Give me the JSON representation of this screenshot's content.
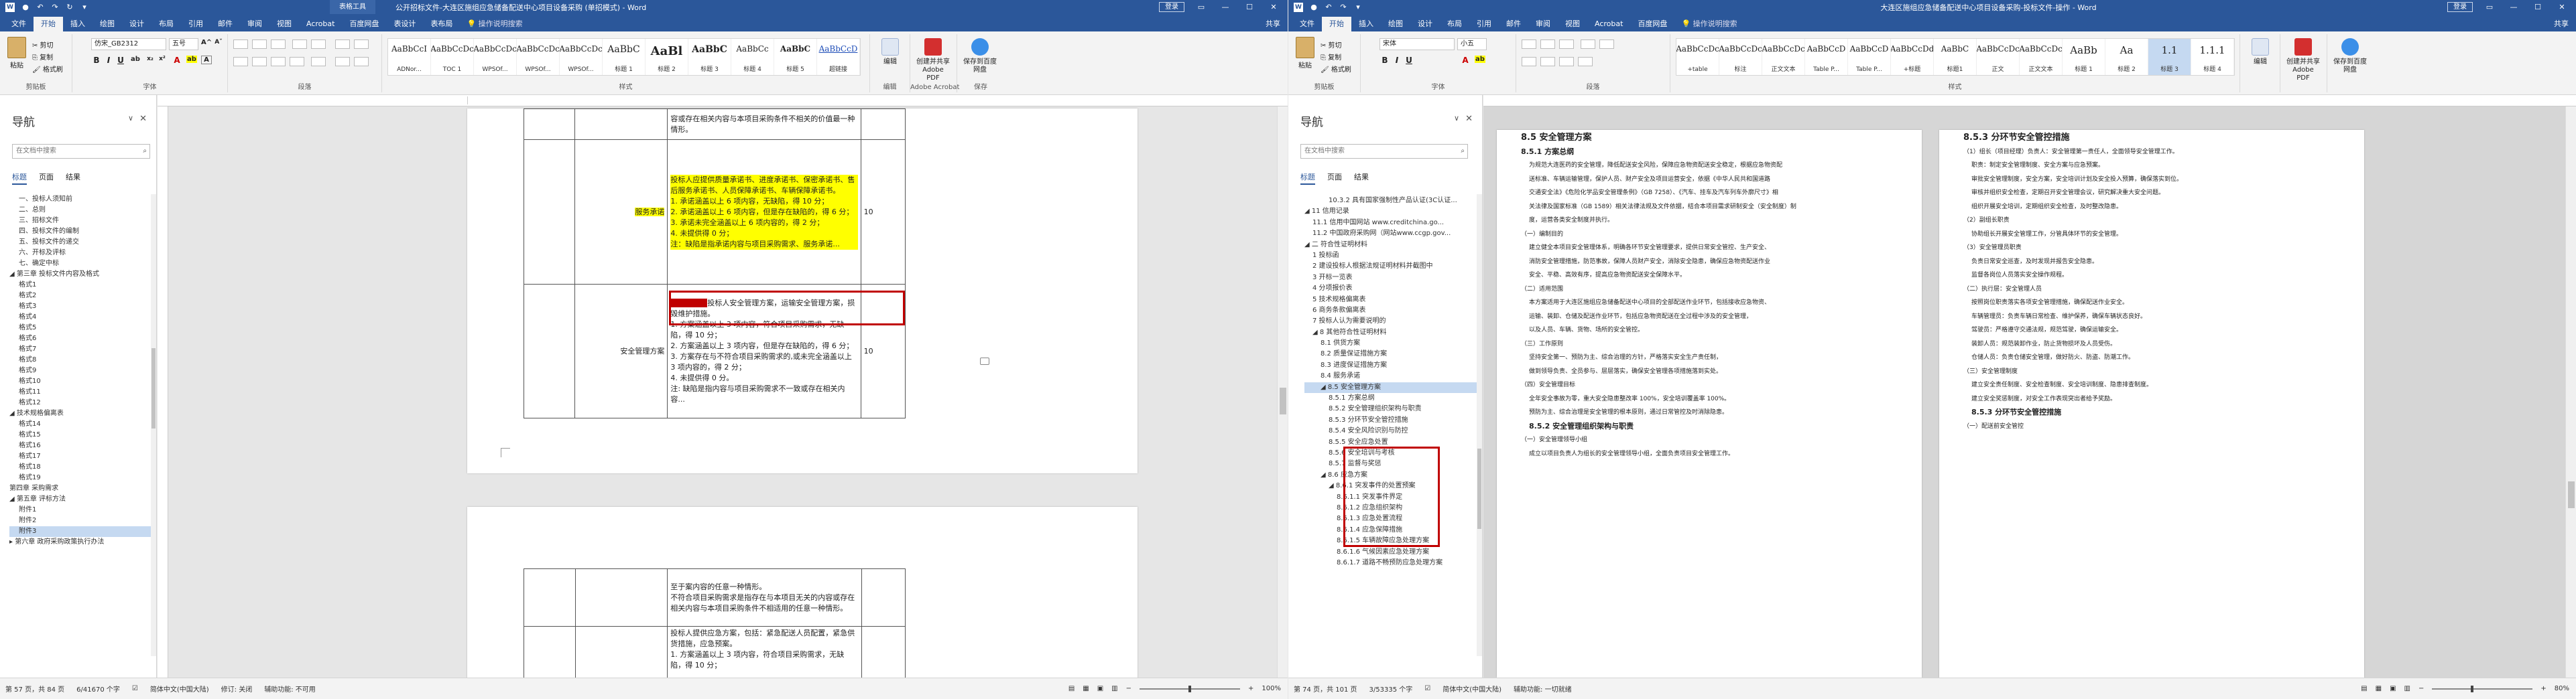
{
  "left_window": {
    "quick_access": [
      "↶",
      "↷",
      "↻",
      "▾"
    ],
    "context_tab": "表格工具",
    "title": "公开招标文件-大连区施组应急储备配送中心项目设备采购 (单招模式) - Word",
    "signin": "登录",
    "tabs": [
      "文件",
      "开始",
      "插入",
      "绘图",
      "设计",
      "布局",
      "引用",
      "邮件",
      "审阅",
      "视图",
      "Acrobat",
      "百度网盘",
      "表设计",
      "表布局"
    ],
    "tell_me": "操作说明搜索",
    "share": "共享",
    "ribbon": {
      "paste": "粘贴",
      "clip_items": [
        "✂ 剪切",
        "⎘ 复制",
        "🖌 格式刷"
      ],
      "clipboard_label": "剪贴板",
      "font_name": "仿宋_GB2312",
      "font_size": "五号",
      "font_label": "字体",
      "paragraph_label": "段落",
      "styles": [
        {
          "sample": "AaBbCcI",
          "name": "ADNor..."
        },
        {
          "sample": "AaBbCcDc",
          "name": "TOC 1"
        },
        {
          "sample": "AaBbCcDc",
          "name": "WPSOf..."
        },
        {
          "sample": "AaBbCcDc",
          "name": "WPSOf..."
        },
        {
          "sample": "AaBbCcDc",
          "name": "WPSOf..."
        },
        {
          "sample": "AaBbC",
          "name": "标题 1"
        },
        {
          "sample": "AaBl",
          "name": "标题 2"
        },
        {
          "sample": "AaBbC",
          "name": "标题 3"
        },
        {
          "sample": "AaBbCc",
          "name": "标题 4"
        },
        {
          "sample": "AaBbC",
          "name": "标题 5"
        },
        {
          "sample": "AaBbCcD",
          "name": "超链接"
        }
      ],
      "styles_label": "样式",
      "edit": "编辑",
      "edit_label": "编辑",
      "acrobat": "创建并共享 Adobe PDF",
      "acrobat_label": "Adobe Acrobat",
      "baidu": "保存到百度网盘",
      "baidu_label": "保存"
    },
    "nav": {
      "title": "导航",
      "search_placeholder": "在文档中搜索",
      "tabs": [
        "标题",
        "页面",
        "结果"
      ],
      "items": [
        {
          "text": "一、投标人须知前",
          "sel": false
        },
        {
          "text": "二、总则",
          "sel": false
        },
        {
          "text": "三、招标文件",
          "sel": false
        },
        {
          "text": "四、投标文件的编制",
          "sel": false
        },
        {
          "text": "五、投标文件的递交",
          "sel": false
        },
        {
          "text": "六、开标及评标",
          "sel": false
        },
        {
          "text": "七、确定中标",
          "sel": false
        },
        {
          "text": "◢ 第三章 投标文件内容及格式",
          "sel": false
        },
        {
          "text": "格式1",
          "sel": false
        },
        {
          "text": "格式2",
          "sel": false
        },
        {
          "text": "格式3",
          "sel": false
        },
        {
          "text": "格式4",
          "sel": false
        },
        {
          "text": "格式5",
          "sel": false
        },
        {
          "text": "格式6",
          "sel": false
        },
        {
          "text": "格式7",
          "sel": false
        },
        {
          "text": "格式8",
          "sel": false
        },
        {
          "text": "格式9",
          "sel": false
        },
        {
          "text": "格式10",
          "sel": false
        },
        {
          "text": "格式11",
          "sel": false
        },
        {
          "text": "格式12",
          "sel": false
        },
        {
          "text": "◢ 技术规格偏离表",
          "sel": false
        },
        {
          "text": "格式14",
          "sel": false
        },
        {
          "text": "格式15",
          "sel": false
        },
        {
          "text": "格式16",
          "sel": false
        },
        {
          "text": "格式17",
          "sel": false
        },
        {
          "text": "格式18",
          "sel": false
        },
        {
          "text": "格式19",
          "sel": false
        },
        {
          "text": "第四章 采购需求",
          "sel": false
        },
        {
          "text": "◢ 第五章 评标方法",
          "sel": false
        },
        {
          "text": "附件1",
          "sel": false
        },
        {
          "text": "附件2",
          "sel": false
        },
        {
          "text": "附件3",
          "sel": true
        },
        {
          "text": "▸ 第六章 政府采购政策执行办法",
          "sel": false
        }
      ]
    },
    "table1": {
      "top_text": "容或存在相关内容与本项目采购条件不相关的价值最一种情形。",
      "service_label": "服务承诺",
      "service_lines": [
        "投标人应提供质量承诺书、进度承诺书、保密承诺书、售后服务承诺书、人员保障承诺书、车辆保障承诺书。",
        "1. 承诺涵盖以上 6 项内容，无缺陷，得 10 分；",
        "2. 承诺涵盖以上 6 项内容，但是存在缺陷的，得 6 分；",
        "3. 承诺未完全涵盖以上 6 项内容的，得 2 分；",
        "4. 未提供得 0 分；",
        "注：缺陷是指承诺内容与项目采购需求、服务承诺..."
      ],
      "service_score": "10",
      "safety_label": "安全管理方案",
      "safety_redacted": "投标人提供",
      "safety_lines": [
        "投标人安全管理方案，运输安全管理方案，损毁维护措施。",
        "1. 方案涵盖以上 3 项内容，符合项目采购需求，无缺陷，得 10 分；",
        "2. 方案涵盖以上 3 项内容，但是存在缺陷的，得 6 分；",
        "3. 方案存在与不符合项目采购需求的,或未完全涵盖以上 3 项内容的，得 2 分；",
        "4. 未提供得 0 分。",
        "注: 缺陷是指内容与项目采购需求不一致或存在相关内容..."
      ],
      "safety_score": "10"
    },
    "table2": {
      "lines1": [
        "至于案内容的任意一种情形。",
        "不符合项目采购需求是指存在与本项目无关的内容或存在相关内容与本项目采购条件不相适用的任意一种情形。"
      ],
      "lines2": [
        "投标人提供应急方案，包括：紧急配送人员配置，紧急供货措施，应急预案。",
        "1. 方案涵盖以上 3 项内容，符合项目采购需求，无缺陷，得 10 分；"
      ]
    },
    "status": {
      "page": "第 57 页，共 84 页",
      "words": "6/41670 个字",
      "lang": "简体中文(中国大陆)",
      "track": "修订: 关闭",
      "access": "辅助功能: 不可用",
      "zoom": "100%"
    }
  },
  "right_window": {
    "title": "大连区施组应急储备配送中心项目设备采购-投标文件-操作 - Word",
    "signin": "登录",
    "tabs": [
      "文件",
      "开始",
      "插入",
      "绘图",
      "设计",
      "布局",
      "引用",
      "邮件",
      "审阅",
      "视图",
      "Acrobat",
      "百度网盘"
    ],
    "tell_me": "操作说明搜索",
    "share": "共享",
    "ribbon": {
      "paste": "粘贴",
      "font_name": "宋体",
      "font_size": "小五",
      "styles": [
        {
          "sample": "AaBbCcDc",
          "name": "+table"
        },
        {
          "sample": "AaBbCcDc",
          "name": "标注"
        },
        {
          "sample": "AaBbCcDc",
          "name": "正文文本"
        },
        {
          "sample": "AaBbCcD",
          "name": "Table P..."
        },
        {
          "sample": "AaBbCcD",
          "name": "Table P..."
        },
        {
          "sample": "AaBbCcDd",
          "name": "+标题"
        },
        {
          "sample": "AaBbC",
          "name": "标题1"
        },
        {
          "sample": "AaBbCcDc",
          "name": "正文"
        },
        {
          "sample": "AaBbCcDc",
          "name": "正文文本"
        },
        {
          "sample": "AaBb",
          "name": "标题 1"
        },
        {
          "sample": "Aa",
          "name": "标题 2"
        },
        {
          "sample": "1.1",
          "name": "标题 3"
        },
        {
          "sample": "1.1.1",
          "name": "标题 4"
        }
      ],
      "styles_label": "样式",
      "edit": "编辑",
      "acrobat": "创建并共享 Adobe PDF",
      "baidu": "保存到百度网盘"
    },
    "nav": {
      "title": "导航",
      "search_placeholder": "在文档中搜索",
      "tabs": [
        "标题",
        "页面",
        "结果"
      ],
      "items": [
        {
          "text": "10.3.2 具有国家强制性产品认证(3C认证...",
          "sel": false,
          "indent": 3
        },
        {
          "text": "◢ 11 信用记录",
          "sel": false,
          "indent": 0
        },
        {
          "text": "11.1 信用中国网站 www.creditchina.go...",
          "sel": false,
          "indent": 1
        },
        {
          "text": "11.2 中国政府采购网（网站www.ccgp.gov...",
          "sel": false,
          "indent": 1
        },
        {
          "text": "◢ 二 符合性证明材料",
          "sel": false,
          "indent": 0
        },
        {
          "text": "1 投标函",
          "sel": false,
          "indent": 1
        },
        {
          "text": "2 建设投标人根据法规证明材料并截图中",
          "sel": false,
          "indent": 1
        },
        {
          "text": "3 开标一览表",
          "sel": false,
          "indent": 1
        },
        {
          "text": "4 分项报价表",
          "sel": false,
          "indent": 1
        },
        {
          "text": "5 技术规格偏离表",
          "sel": false,
          "indent": 1
        },
        {
          "text": "6 商务条款偏离表",
          "sel": false,
          "indent": 1
        },
        {
          "text": "7 投标人认为需要说明的",
          "sel": false,
          "indent": 1
        },
        {
          "text": "◢ 8 其他符合性证明材料",
          "sel": false,
          "indent": 1
        },
        {
          "text": "8.1 供货方案",
          "sel": false,
          "indent": 2
        },
        {
          "text": "8.2 质量保证措施方案",
          "sel": false,
          "indent": 2
        },
        {
          "text": "8.3 进度保证措施方案",
          "sel": false,
          "indent": 2
        },
        {
          "text": "8.4 服务承诺",
          "sel": false,
          "indent": 2
        },
        {
          "text": "◢ 8.5 安全管理方案",
          "sel": true,
          "indent": 2
        },
        {
          "text": "8.5.1 方案总纲",
          "sel": false,
          "indent": 3
        },
        {
          "text": "8.5.2 安全管理组织架构与职责",
          "sel": false,
          "indent": 3
        },
        {
          "text": "8.5.3 分环节安全管控措施",
          "sel": false,
          "indent": 3
        },
        {
          "text": "8.5.4 安全风险识别与防控",
          "sel": false,
          "indent": 3
        },
        {
          "text": "8.5.5 安全应急处置",
          "sel": false,
          "indent": 3
        },
        {
          "text": "8.5.6 安全培训与考核",
          "sel": false,
          "indent": 3
        },
        {
          "text": "8.5.7 监督与奖惩",
          "sel": false,
          "indent": 3
        },
        {
          "text": "◢ 8.6 应急方案",
          "sel": false,
          "indent": 2
        },
        {
          "text": "◢ 8.6.1 突发事件的处置预案",
          "sel": false,
          "indent": 3
        },
        {
          "text": "8.6.1.1 突发事件界定",
          "sel": false,
          "indent": 4
        },
        {
          "text": "8.6.1.2 应急组织架构",
          "sel": false,
          "indent": 4
        },
        {
          "text": "8.6.1.3 应急处置流程",
          "sel": false,
          "indent": 4
        },
        {
          "text": "8.6.1.4 应急保障措施",
          "sel": false,
          "indent": 4
        },
        {
          "text": "8.6.1.5 车辆故障应急处理方案",
          "sel": false,
          "indent": 4
        },
        {
          "text": "8.6.1.6 气候因素应急处理方案",
          "sel": false,
          "indent": 4
        },
        {
          "text": "8.6.1.7 道路不畅预防应急处理方案",
          "sel": false,
          "indent": 4
        }
      ]
    },
    "page_left": {
      "heading": "8.5 安全管理方案",
      "h1": "8.5.1 方案总纲",
      "h2": "8.5.2 安全管理组织架构与职责",
      "lines": [
        "为规范大连医药的安全管理，降低配送安全风险，保障应急物资配送安全稳定，根据应急物资配",
        "送标准、车辆运输管理，保护人员、财产安全及项目运营安全，依据《中华人民共和国道路",
        "交通安全法》《危险化学品安全管理条例》（GB 7258）、《汽车、挂车及汽车列车外廓尺寸》相",
        "关法律及国家标准（GB 1589）相关法律法规及文件依据，结合本项目需求研制安全（安全制度）制",
        "度，运营各类安全制度并执行。",
        "（一）编制目的",
        "建立健全本项目安全管理体系，明确各环节安全管理要求，提供日常安全管控、生产安全、",
        "消防安全管理措施，防范事故，保障人员财产安全，消除安全隐患，确保应急物资配送作业",
        "安全、平稳、高效有序，提高应急物资配送安全保障水平。",
        "（二）适用范围",
        "本方案适用于大连区施组应急储备配送中心项目的全部配送作业环节，包括接收应急物资、",
        "运输、装卸、仓储及配送作业环节，包括应急物资配送在全过程中涉及的安全管理，",
        "以及人员、车辆、货物、场所的安全管控。",
        "（三）工作原则",
        "坚持安全第一、预防为主、综合治理的方针，严格落实安全生产责任制，",
        "做到领导负责、全员参与、层层落实，确保安全管理各项措施落到实处。",
        "（四）安全管理目标",
        "全年安全事故为零，重大安全隐患整改率 100%，安全培训覆盖率 100%。",
        "预防为主、综合治理是安全管理的根本原则，通过日常管控及时消除隐患。",
        "8.5.2 安全管理组织架构与职责",
        "（一）安全管理领导小组",
        "成立以项目负责人为组长的安全管理领导小组，全面负责项目安全管理工作。"
      ]
    },
    "page_right": {
      "heading": "8.5.3 分环节安全管控措施",
      "lines": [
        "（1）组长（项目经理）负责人：安全管理第一责任人，全面领导安全管理工作。",
        "  职责：制定安全管理制度、安全方案与应急预案。",
        "  审批安全管理制度，安全方案，安全培训计划及安全投入预算，确保落实到位。",
        "  审核并组织安全检查，定期召开安全管理会议，研究解决重大安全问题。",
        "  组织开展安全培训，定期组织安全检查，及时整改隐患。",
        "（2）副组长职责",
        "  协助组长开展安全管理工作，分管具体环节的安全管理。",
        "（3）安全管理员职责",
        "  负责日常安全巡查，及时发现并报告安全隐患。",
        "  监督各岗位人员落实安全操作规程。",
        "（二）执行层：安全管理人员",
        "  按照岗位职责落实各项安全管理措施，确保配送作业安全。",
        "  车辆管理员：负责车辆日常检查、维护保养，确保车辆状态良好。",
        "  驾驶员：严格遵守交通法规，规范驾驶，确保运输安全。",
        "  装卸人员：规范装卸作业，防止货物损坏及人员受伤。",
        "  仓储人员：负责仓储安全管理，做好防火、防盗、防潮工作。",
        "（三）安全管理制度",
        "  建立安全责任制度、安全检查制度、安全培训制度、隐患排查制度。",
        "  建立安全奖惩制度，对安全工作表现突出者给予奖励。",
        "8.5.3 分环节安全管控措施",
        "（一）配送前安全管控"
      ]
    },
    "status": {
      "page": "第 74 页，共 101 页",
      "words": "3/53335 个字",
      "lang": "简体中文(中国大陆)",
      "access": "辅助功能: 一切就绪",
      "zoom": "80%"
    }
  }
}
